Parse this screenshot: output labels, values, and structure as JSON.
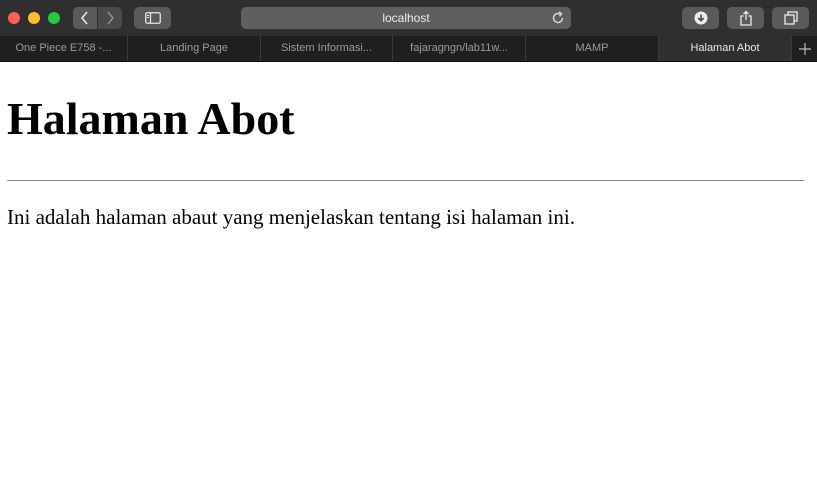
{
  "browser": {
    "url": "localhost",
    "tabs": [
      {
        "label": "One Piece E758 -..."
      },
      {
        "label": "Landing Page"
      },
      {
        "label": "Sistem Informasi..."
      },
      {
        "label": "fajaragngn/lab11w..."
      },
      {
        "label": "MAMP"
      },
      {
        "label": "Halaman Abot",
        "active": true
      }
    ],
    "icons": [
      "back-icon",
      "forward-icon",
      "sidebar-icon",
      "reload-icon",
      "download-icon",
      "share-icon",
      "tab-overview-icon",
      "new-tab-icon"
    ]
  },
  "page": {
    "heading": "Halaman Abot",
    "body_text": "Ini adalah halaman abaut yang menjelaskan tentang isi halaman ini."
  }
}
